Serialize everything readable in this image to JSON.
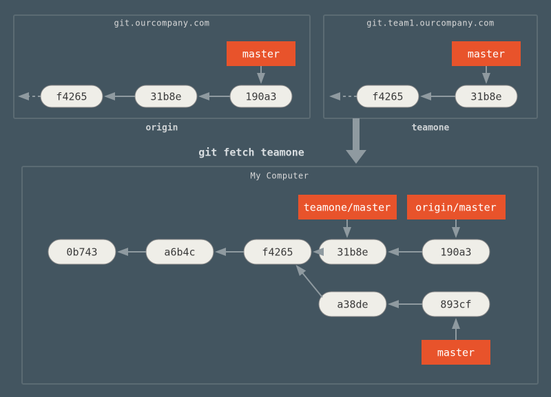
{
  "origin_box": {
    "url": "git.ourcompany.com",
    "label": "origin",
    "branch": "master",
    "commits": [
      "f4265",
      "31b8e",
      "190a3"
    ]
  },
  "teamone_box": {
    "url": "git.team1.ourcompany.com",
    "label": "teamone",
    "branch": "master",
    "commits": [
      "f4265",
      "31b8e"
    ]
  },
  "local_box": {
    "title": "My Computer",
    "teamone_ref": "teamone/master",
    "origin_ref": "origin/master",
    "local_branch": "master",
    "commits_row1": [
      "0b743",
      "a6b4c",
      "f4265",
      "31b8e",
      "190a3"
    ],
    "commits_row2": [
      "a38de",
      "893cf"
    ]
  },
  "command": "git fetch teamone"
}
